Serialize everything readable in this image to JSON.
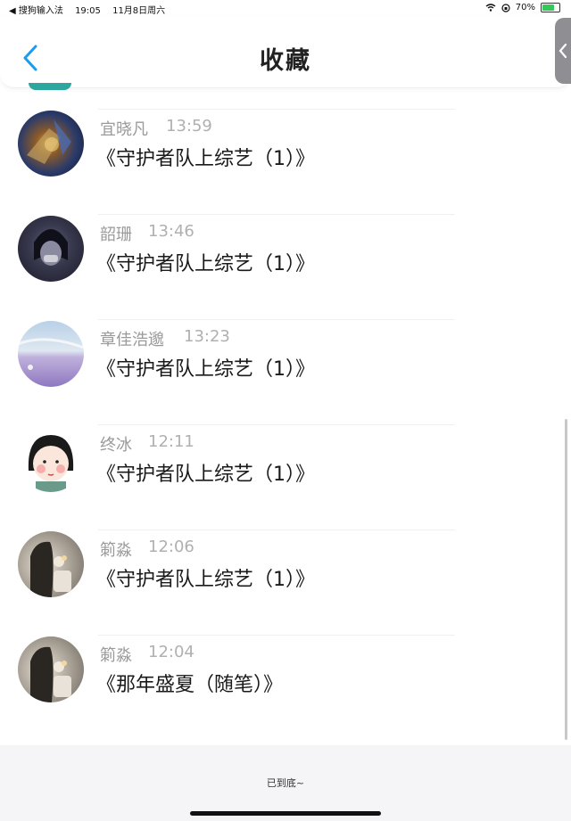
{
  "status_bar": {
    "back_app": "◀ 搜狗输入法",
    "time": "19:05",
    "date": "11月8日周六",
    "battery": "70%",
    "battery_level": 0.7
  },
  "header": {
    "title": "收藏"
  },
  "items": [
    {
      "author": "宜晓凡",
      "time": "13:59",
      "title": "《守护者队上综艺（1）》"
    },
    {
      "author": "韶珊",
      "time": "13:46",
      "title": "《守护者队上综艺（1）》"
    },
    {
      "author": "章佳浩邈",
      "time": "13:23",
      "title": "《守护者队上综艺（1）》"
    },
    {
      "author": "终冰",
      "time": "12:11",
      "title": "《守护者队上综艺（1）》"
    },
    {
      "author": "箣淼",
      "time": "12:06",
      "title": "《守护者队上综艺（1）》"
    },
    {
      "author": "箣淼",
      "time": "12:04",
      "title": "《那年盛夏（随笔）》"
    }
  ],
  "footer": {
    "end_text": "已到底~"
  },
  "colors": {
    "accent": "#1a9cf0",
    "footer_bg": "#f5f5f7"
  }
}
